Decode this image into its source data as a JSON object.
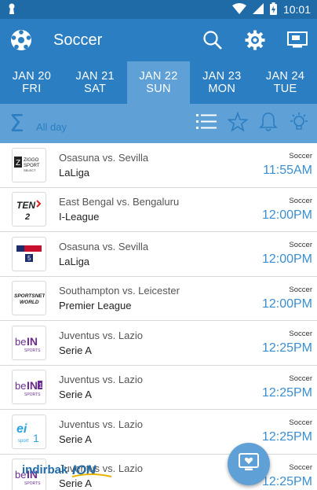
{
  "status": {
    "time": "10:01"
  },
  "app": {
    "title": "Soccer"
  },
  "date_tabs": [
    {
      "month_day": "JAN 20",
      "weekday": "FRI"
    },
    {
      "month_day": "JAN 21",
      "weekday": "SAT"
    },
    {
      "month_day": "JAN 22",
      "weekday": "SUN"
    },
    {
      "month_day": "JAN 23",
      "weekday": "MON"
    },
    {
      "month_day": "JAN 24",
      "weekday": "TUE"
    }
  ],
  "filter": {
    "label": "All day"
  },
  "matches": [
    {
      "channel": "Ziggo Sport Select",
      "title": "Osasuna vs. Sevilla",
      "league": "LaLiga",
      "sport": "Soccer",
      "time": "11:55AM"
    },
    {
      "channel": "TEN 2",
      "title": "East Bengal vs. Bengaluru",
      "league": "I-League",
      "sport": "Soccer",
      "time": "12:00PM"
    },
    {
      "channel": "Sky Sports 5",
      "title": "Osasuna vs. Sevilla",
      "league": "LaLiga",
      "sport": "Soccer",
      "time": "12:00PM"
    },
    {
      "channel": "SportsNet World",
      "title": "Southampton vs. Leicester",
      "league": "Premier League",
      "sport": "Soccer",
      "time": "12:00PM"
    },
    {
      "channel": "beIN Sports",
      "title": "Juventus vs. Lazio",
      "league": "Serie A",
      "sport": "Soccer",
      "time": "12:25PM"
    },
    {
      "channel": "beIN Sports 1",
      "title": "Juventus vs. Lazio",
      "league": "Serie A",
      "sport": "Soccer",
      "time": "12:25PM"
    },
    {
      "channel": "eir sport 1",
      "title": "Juventus vs. Lazio",
      "league": "Serie A",
      "sport": "Soccer",
      "time": "12:25PM"
    },
    {
      "channel": "beIN Sports",
      "title": "Juventus vs. Lazio",
      "league": "Serie A",
      "sport": "Soccer",
      "time": "12:25PM"
    }
  ],
  "watermark": {
    "text": "indirbak",
    "logo": "ION"
  },
  "colors": {
    "primary": "#2b7ec1",
    "status_bar": "#1e6ba8",
    "accent": "#5fa0d6",
    "time_text": "#3b8ed0"
  },
  "icons": [
    "soccer-ball-icon",
    "search-icon",
    "settings-icon",
    "cast-icon",
    "sigma-icon",
    "list-icon",
    "star-icon",
    "bell-icon",
    "lightbulb-icon",
    "tv-heart-icon"
  ]
}
